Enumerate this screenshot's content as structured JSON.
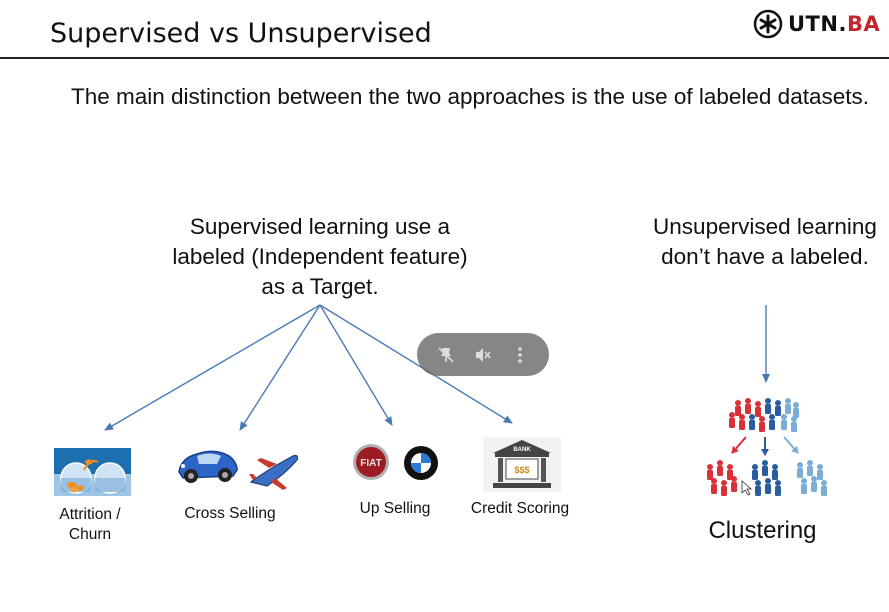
{
  "slide": {
    "title": "Supervised vs Unsupervised",
    "intro": "The main distinction between the two approaches is the use of labeled datasets.",
    "supervised_text": "Supervised learning use a labeled (Independent feature) as a Target.",
    "unsupervised_text": "Unsupervised learning don’t have a labeled."
  },
  "logo": {
    "text_dark": "UTN.",
    "text_red": "BA"
  },
  "examples": {
    "attrition": "Attrition / Churn",
    "cross_selling": "Cross Selling",
    "up_selling": "Up Selling",
    "credit_scoring": "Credit Scoring",
    "clustering": "Clustering"
  },
  "bank_sign": {
    "top": "BANK",
    "bottom": "$$$"
  },
  "colors": {
    "arrow": "#4a7ab5",
    "logo_red": "#c0272d",
    "cluster_red": "#d9313a",
    "cluster_blue": "#2a5d9f",
    "cluster_light": "#7aaed6"
  },
  "video_overlay": {
    "icons": [
      "pin-off-icon",
      "mute-icon",
      "more-vertical-icon"
    ]
  }
}
